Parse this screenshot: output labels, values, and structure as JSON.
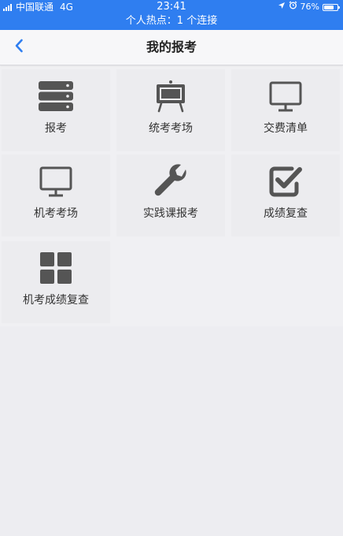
{
  "status_bar": {
    "carrier": "中国联通",
    "network": "4G",
    "time": "23:41",
    "battery_percent": "76%",
    "battery_level": 0.76,
    "hotspot_text": "个人热点：1 个连接",
    "icons": [
      "signal-icon",
      "location-arrow-icon",
      "alarm-icon",
      "battery-icon"
    ]
  },
  "nav": {
    "title": "我的报考",
    "back_icon": "chevron-left-icon"
  },
  "colors": {
    "accent": "#2f7ef0",
    "icon_gray": "#555555",
    "page_bg": "#f0f0f3"
  },
  "menu": [
    {
      "label": "报考",
      "icon": "server-stack-icon"
    },
    {
      "label": "统考考场",
      "icon": "easel-board-icon"
    },
    {
      "label": "交费清单",
      "icon": "monitor-icon"
    },
    {
      "label": "机考考场",
      "icon": "monitor-icon"
    },
    {
      "label": "实践课报考",
      "icon": "wrench-icon"
    },
    {
      "label": "成绩复查",
      "icon": "checkbox-icon"
    },
    {
      "label": "机考成绩复查",
      "icon": "grid-icon"
    }
  ]
}
